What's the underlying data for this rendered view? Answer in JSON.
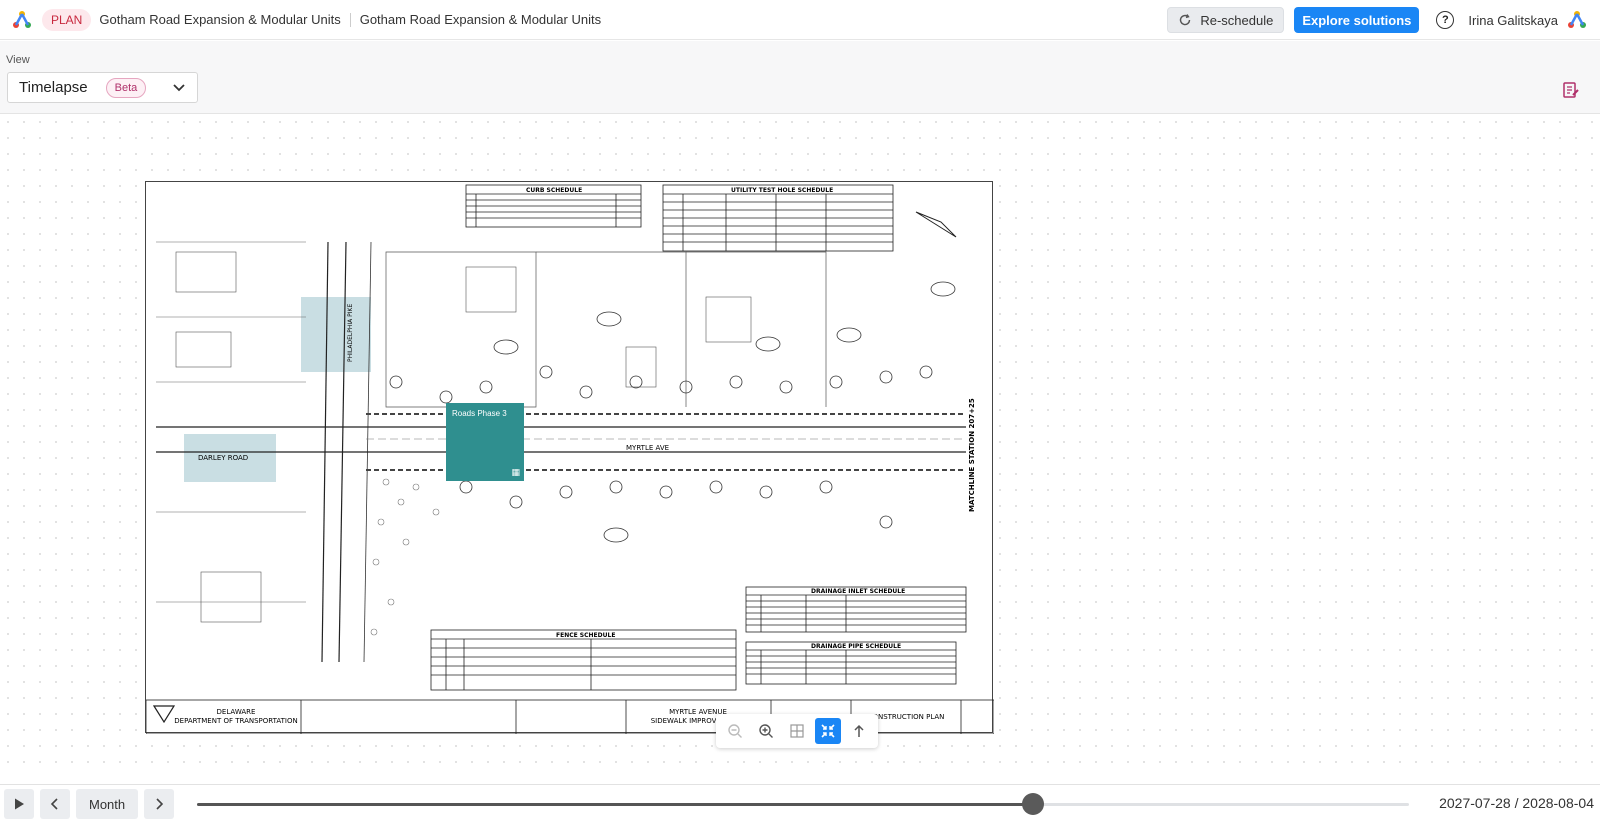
{
  "header": {
    "plan_badge": "PLAN",
    "project_name": "Gotham Road Expansion & Modular Units",
    "plan_name": "Gotham Road Expansion & Modular Units",
    "reschedule_label": "Re-schedule",
    "explore_label": "Explore solutions",
    "help_label": "?",
    "user_name": "Irina Galitskaya"
  },
  "view": {
    "label": "View",
    "selected": "Timelapse",
    "badge": "Beta"
  },
  "drawing": {
    "phase_label": "Roads Phase 3",
    "curb_title": "CURB SCHEDULE",
    "utility_title": "UTILITY TEST HOLE SCHEDULE",
    "drainage_inlet_title": "DRAINAGE INLET SCHEDULE",
    "drainage_pipe_title": "DRAINAGE PIPE SCHEDULE",
    "fence_title": "FENCE SCHEDULE",
    "street_label": "MYRTLE AVE",
    "darley_label": "DARLEY ROAD",
    "pike_label": "PHILADELPHIA PIKE",
    "matchline": "MATCHLINE STATION 207+25",
    "agency_line1": "DELAWARE",
    "agency_line2": "DEPARTMENT OF TRANSPORTATION",
    "project_line1": "MYRTLE AVENUE",
    "project_line2": "SIDEWALK IMPROVEMENTS",
    "sheet_type": "CONSTRUCTION PLAN"
  },
  "timeline": {
    "interval": "Month",
    "date_range": "2027-07-28 / 2028-08-04",
    "progress": 0.69
  },
  "colors": {
    "accent": "#1a86f5",
    "phase": "#2f8f8f",
    "plan_badge": "#c8293f"
  },
  "icons": {
    "reschedule": "refresh-icon",
    "play": "play-icon",
    "prev": "chevron-left-icon",
    "next": "chevron-right-icon",
    "notes": "notes-edit-icon"
  }
}
